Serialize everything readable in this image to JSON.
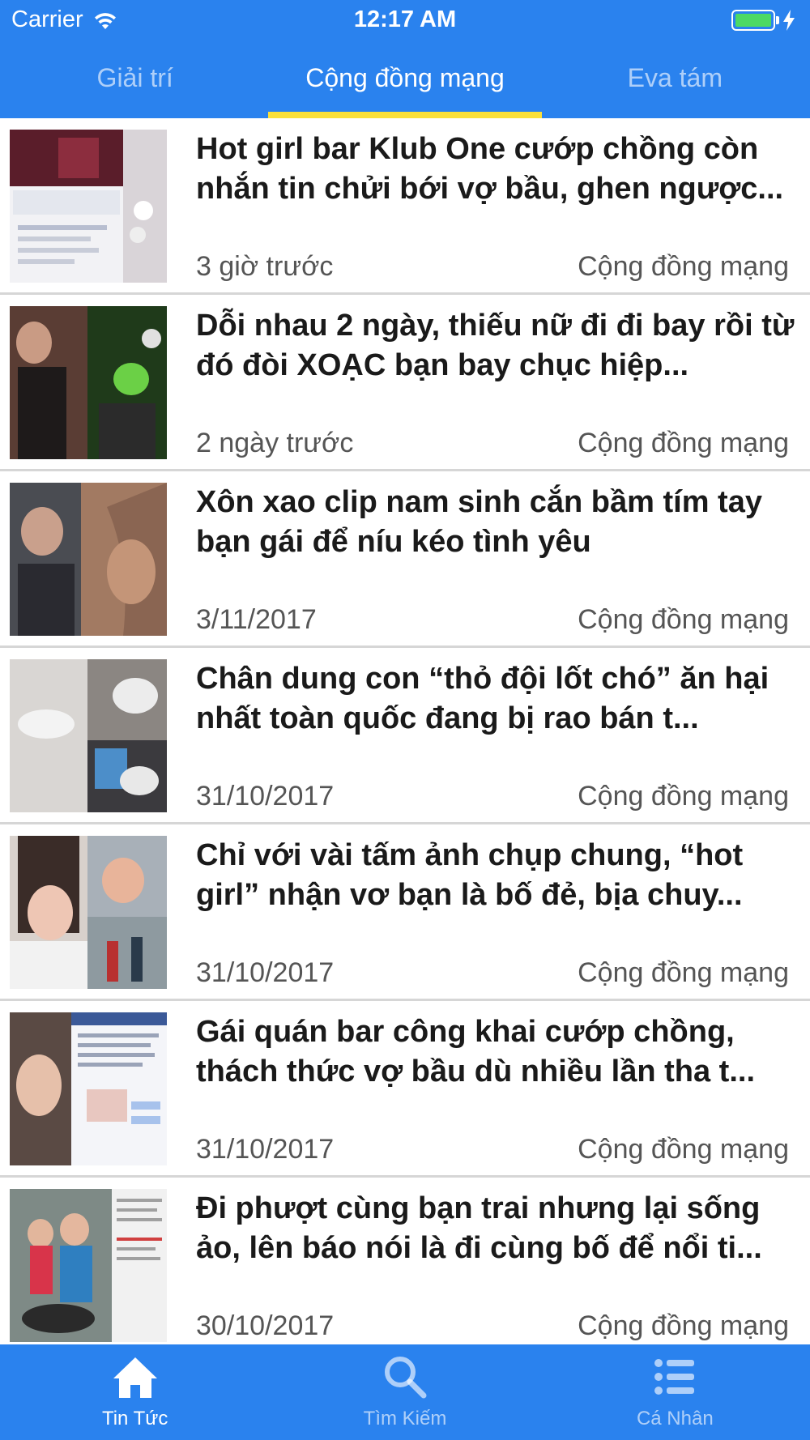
{
  "status_bar": {
    "carrier": "Carrier",
    "time": "12:17 AM",
    "wifi_icon": "wifi-icon",
    "battery_icon": "battery-icon",
    "charging_icon": "bolt-icon",
    "battery_color": "#4cd964"
  },
  "top_tabs": [
    {
      "label": "Giải trí",
      "active": false
    },
    {
      "label": "Cộng đồng mạng",
      "active": true
    },
    {
      "label": "Eva tám",
      "active": false
    }
  ],
  "colors": {
    "header": "#2a82ee",
    "tab_indicator": "#fbe03a",
    "divider": "#d6d6d6"
  },
  "articles": [
    {
      "title": "Hot girl bar Klub One cướp chồng còn nhắn tin chửi bới vợ bầu, ghen ngược...",
      "time": "3 giờ trước",
      "category": "Cộng đồng mạng"
    },
    {
      "title": "Dỗi nhau 2 ngày, thiếu nữ đi đi bay rồi từ đó đòi XOẠC bạn bay chục hiệp...",
      "time": "2 ngày trước",
      "category": "Cộng đồng mạng"
    },
    {
      "title": "Xôn xao clip nam sinh cắn bầm tím tay bạn gái để níu kéo tình yêu",
      "time": "3/11/2017",
      "category": "Cộng đồng mạng"
    },
    {
      "title": "Chân dung con “thỏ đội lốt chó” ăn hại nhất toàn quốc đang bị rao bán t...",
      "time": "31/10/2017",
      "category": "Cộng đồng mạng"
    },
    {
      "title": "Chỉ với vài tấm ảnh chụp chung, “hot girl” nhận vơ bạn là bố đẻ, bịa chuy...",
      "time": "31/10/2017",
      "category": "Cộng đồng mạng"
    },
    {
      "title": "Gái quán bar công khai cướp chồng, thách thức vợ bầu dù nhiều lần tha t...",
      "time": "31/10/2017",
      "category": "Cộng đồng mạng"
    },
    {
      "title": "Đi phượt cùng bạn trai nhưng lại sống ảo, lên báo nói là đi cùng bố để nổi ti...",
      "time": "30/10/2017",
      "category": "Cộng đồng mạng"
    }
  ],
  "bottom_tabs": [
    {
      "label": "Tin Tức",
      "icon": "home-icon",
      "active": true
    },
    {
      "label": "Tìm Kiếm",
      "icon": "search-icon",
      "active": false
    },
    {
      "label": "Cá Nhân",
      "icon": "list-icon",
      "active": false
    }
  ]
}
